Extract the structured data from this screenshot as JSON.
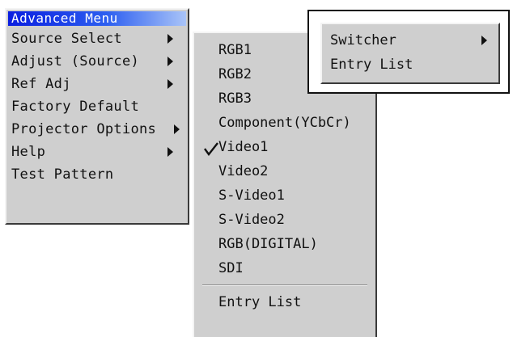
{
  "main_menu": {
    "title": "Advanced Menu",
    "items": [
      {
        "label": "Source Select",
        "submenu": true
      },
      {
        "label": "Adjust (Source)",
        "submenu": true
      },
      {
        "label": "Ref Adj",
        "submenu": true
      },
      {
        "label": "Factory Default",
        "submenu": false
      },
      {
        "label": "Projector Options",
        "submenu": true
      },
      {
        "label": "Help",
        "submenu": true
      },
      {
        "label": "Test Pattern",
        "submenu": false
      }
    ]
  },
  "source_submenu": {
    "items": [
      {
        "label": "RGB1",
        "checked": false
      },
      {
        "label": "RGB2",
        "checked": false
      },
      {
        "label": "RGB3",
        "checked": false
      },
      {
        "label": "Component(YCbCr)",
        "checked": false
      },
      {
        "label": "Video1",
        "checked": true
      },
      {
        "label": "Video2",
        "checked": false
      },
      {
        "label": "S-Video1",
        "checked": false
      },
      {
        "label": "S-Video2",
        "checked": false
      },
      {
        "label": "RGB(DIGITAL)",
        "checked": false
      },
      {
        "label": "SDI",
        "checked": false
      }
    ],
    "entry_list": "Entry List"
  },
  "switcher_menu": {
    "items": [
      {
        "label": "Switcher",
        "submenu": true
      },
      {
        "label": "Entry List",
        "submenu": false
      }
    ]
  },
  "colors": {
    "menu_bg": "#cfcfcf",
    "title_bar_start": "#0a1ee0",
    "title_bar_end": "#a9c4f8"
  }
}
